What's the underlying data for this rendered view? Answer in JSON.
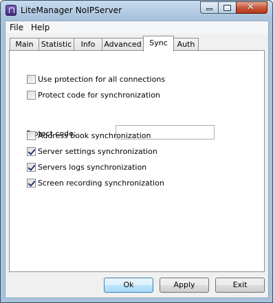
{
  "window": {
    "title": "LiteManager NoIPServer"
  },
  "menu": {
    "file": "File",
    "help": "Help"
  },
  "tabs": [
    "Main",
    "Statistic",
    "Info",
    "Advanced",
    "Sync",
    "Auth"
  ],
  "active_tab": "Sync",
  "options": [
    {
      "label": "Use protection for all connections",
      "checked": false
    },
    {
      "label": "Protect code for synchronization",
      "checked": false
    },
    {
      "label": "Address book synchronization",
      "checked": false
    },
    {
      "label": "Server settings synchronization",
      "checked": true
    },
    {
      "label": "Servers logs synchronization",
      "checked": true
    },
    {
      "label": "Screen recording synchronization",
      "checked": true
    }
  ],
  "protect_code": {
    "label": "Protect code:",
    "value": ""
  },
  "buttons": {
    "ok": "Ok",
    "apply": "Apply",
    "exit": "Exit"
  }
}
